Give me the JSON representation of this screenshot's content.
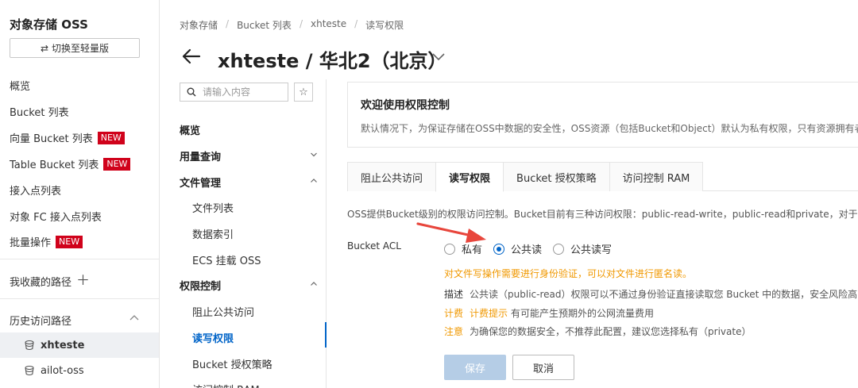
{
  "sidebar": {
    "title": "对象存储 OSS",
    "switch_label": "切换至轻量版",
    "items": [
      {
        "label": "概览"
      },
      {
        "label": "Bucket 列表"
      },
      {
        "label": "向量 Bucket 列表",
        "badge": "NEW"
      },
      {
        "label": "Table Bucket 列表",
        "badge": "NEW"
      },
      {
        "label": "接入点列表"
      },
      {
        "label": "对象 FC 接入点列表"
      },
      {
        "label": "批量操作",
        "badge": "NEW"
      }
    ],
    "favorites_label": "我收藏的路径",
    "history_label": "历史访问路径",
    "history": [
      {
        "label": "xhteste"
      },
      {
        "label": "ailot-oss"
      }
    ]
  },
  "header": {
    "breadcrumb": [
      "对象存储",
      "Bucket 列表",
      "xhteste",
      "读写权限"
    ],
    "title": "xhteste / 华北2（北京）"
  },
  "nav": {
    "search_placeholder": "请输入内容",
    "overview": "概览",
    "usage": "用量查询",
    "file_mgmt": "文件管理",
    "file_list": "文件列表",
    "data_index": "数据索引",
    "ecs_mount": "ECS 挂载 OSS",
    "perm_ctrl": "权限控制",
    "block_public": "阻止公共访问",
    "rw_perm": "读写权限",
    "bucket_policy": "Bucket 授权策略",
    "ram": "访问控制 RAM"
  },
  "main": {
    "welcome_title": "欢迎使用权限控制",
    "welcome_desc": "默认情况下，为保证存储在OSS中数据的安全性，OSS资源（包括Bucket和Object）默认为私有权限，只有资源拥有者",
    "tabs": [
      "阻止公共访问",
      "读写权限",
      "Bucket 授权策略",
      "访问控制 RAM"
    ],
    "acl_desc": "OSS提供Bucket级别的权限访问控制。Bucket目前有三种访问权限：public-read-write，public-read和private，对于priva",
    "acl_label": "Bucket ACL",
    "options": [
      "私有",
      "公共读",
      "公共读写"
    ],
    "selected_option": "公共读",
    "warning": "对文件写操作需要进行身份验证，可以对文件进行匿名读。",
    "describe_key": "描述",
    "describe_val": "公共读（public-read）权限可以不通过身份验证直接读取您 Bucket 中的数据，安全风险高",
    "billing_key": "计费",
    "billing_hint": "计费提示",
    "billing_val": "有可能产生预期外的公网流量费用",
    "note_key": "注意",
    "note_val": "为确保您的数据安全，不推荐此配置，建议您选择私有（private）",
    "save": "保存",
    "cancel": "取消"
  },
  "colors": {
    "accent": "#0064c8",
    "badge": "#d0021b",
    "warning": "#f09800",
    "annotation_arrow": "#e8463c"
  }
}
